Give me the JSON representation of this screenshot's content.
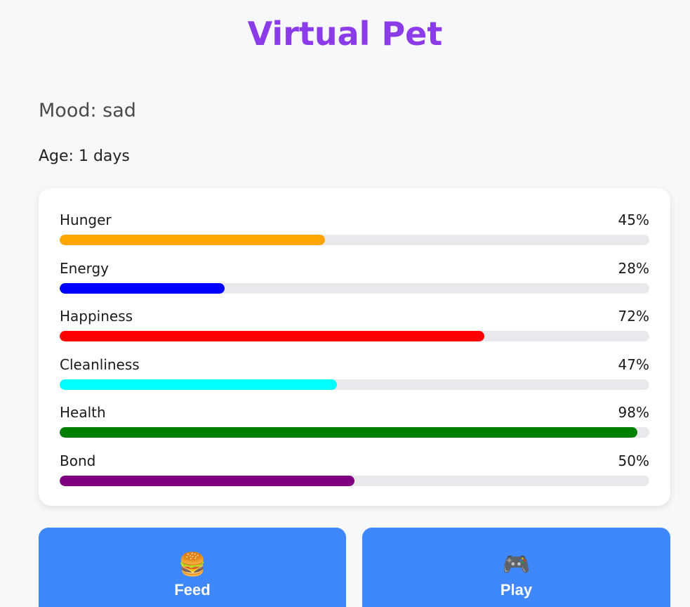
{
  "app": {
    "title": "Virtual Pet"
  },
  "pet": {
    "mood_text": "Mood: sad",
    "age_text": "Age: 1 days"
  },
  "stats": [
    {
      "label": "Hunger",
      "percent_text": "45%",
      "value": 45,
      "color": "#ffa500"
    },
    {
      "label": "Energy",
      "percent_text": "28%",
      "value": 28,
      "color": "#0000ff"
    },
    {
      "label": "Happiness",
      "percent_text": "72%",
      "value": 72,
      "color": "#ff0000"
    },
    {
      "label": "Cleanliness",
      "percent_text": "47%",
      "value": 47,
      "color": "#00ffff"
    },
    {
      "label": "Health",
      "percent_text": "98%",
      "value": 98,
      "color": "#008000"
    },
    {
      "label": "Bond",
      "percent_text": "50%",
      "value": 50,
      "color": "#800080"
    }
  ],
  "actions": [
    {
      "label": "Feed",
      "icon": "🍔",
      "icon_name": "burger-icon"
    },
    {
      "label": "Play",
      "icon": "🎮",
      "icon_name": "gamepad-icon"
    }
  ],
  "colors": {
    "title": "#8b3be8",
    "button": "#3f87fc",
    "track": "#e7e9ec"
  }
}
